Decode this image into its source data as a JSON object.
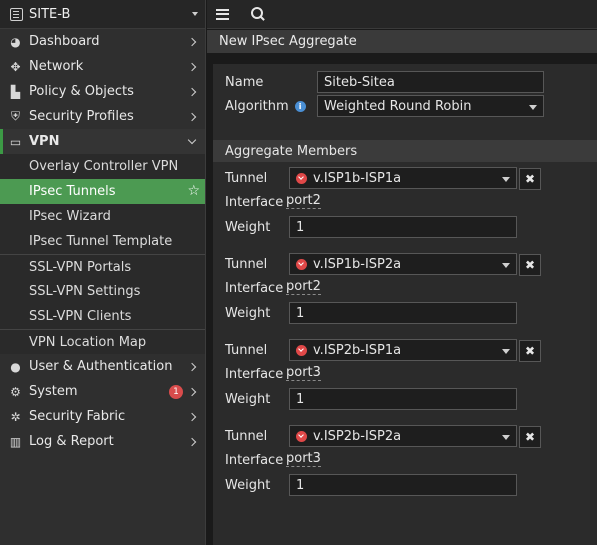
{
  "sidebar": {
    "device": "SITE-B",
    "items": [
      {
        "label": "Dashboard",
        "icon": "dashboard-icon"
      },
      {
        "label": "Network",
        "icon": "network-icon"
      },
      {
        "label": "Policy & Objects",
        "icon": "policy-icon"
      },
      {
        "label": "Security Profiles",
        "icon": "security-profiles-icon"
      },
      {
        "label": "VPN",
        "icon": "vpn-icon"
      }
    ],
    "vpn_subitems": [
      {
        "label": "Overlay Controller VPN"
      },
      {
        "label": "IPsec Tunnels"
      },
      {
        "label": "IPsec Wizard"
      },
      {
        "label": "IPsec Tunnel Template"
      },
      {
        "label": "SSL-VPN Portals"
      },
      {
        "label": "SSL-VPN Settings"
      },
      {
        "label": "SSL-VPN Clients"
      },
      {
        "label": "VPN Location Map"
      }
    ],
    "bottom_items": [
      {
        "label": "User & Authentication",
        "icon": "user-icon"
      },
      {
        "label": "System",
        "icon": "gear-icon",
        "badge": "1"
      },
      {
        "label": "Security Fabric",
        "icon": "fabric-icon"
      },
      {
        "label": "Log & Report",
        "icon": "chart-icon"
      }
    ]
  },
  "page": {
    "title": "New IPsec Aggregate"
  },
  "form": {
    "name_label": "Name",
    "name_value": "Siteb-Sitea",
    "algorithm_label": "Algorithm",
    "algorithm_value": "Weighted Round Robin",
    "members_header": "Aggregate Members",
    "tunnel_label": "Tunnel",
    "interface_label": "Interface",
    "weight_label": "Weight",
    "members": [
      {
        "tunnel": "v.ISP1b-ISP1a",
        "interface": "port2",
        "weight": "1"
      },
      {
        "tunnel": "v.ISP1b-ISP2a",
        "interface": "port2",
        "weight": "1"
      },
      {
        "tunnel": "v.ISP2b-ISP1a",
        "interface": "port3",
        "weight": "1"
      },
      {
        "tunnel": "v.ISP2b-ISP2a",
        "interface": "port3",
        "weight": "1"
      }
    ]
  },
  "colors": {
    "accent_green": "#4c9a52",
    "badge_red": "#d94c4c"
  }
}
